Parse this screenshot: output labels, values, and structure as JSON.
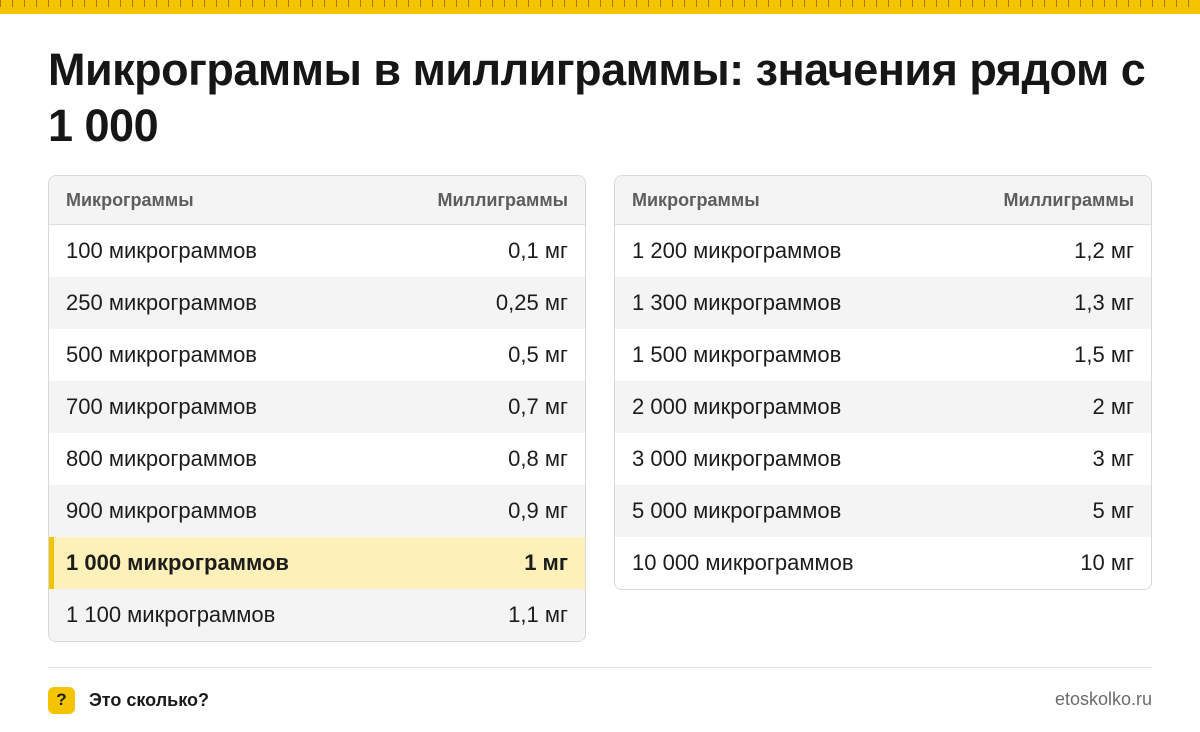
{
  "title": "Микрограммы в миллиграммы: значения рядом с 1 000",
  "tables": [
    {
      "headers": {
        "col1": "Микрограммы",
        "col2": "Миллиграммы"
      },
      "rows": [
        {
          "mcg": "100 микрограммов",
          "mg": "0,1 мг"
        },
        {
          "mcg": "250 микрограммов",
          "mg": "0,25 мг"
        },
        {
          "mcg": "500 микрограммов",
          "mg": "0,5 мг"
        },
        {
          "mcg": "700 микрограммов",
          "mg": "0,7 мг"
        },
        {
          "mcg": "800 микрограммов",
          "mg": "0,8 мг"
        },
        {
          "mcg": "900 микрограммов",
          "mg": "0,9 мг"
        },
        {
          "mcg": "1 000 микрограммов",
          "mg": "1 мг",
          "highlight": true
        },
        {
          "mcg": "1 100 микрограммов",
          "mg": "1,1 мг"
        }
      ]
    },
    {
      "headers": {
        "col1": "Микрограммы",
        "col2": "Миллиграммы"
      },
      "rows": [
        {
          "mcg": "1 200 микрограммов",
          "mg": "1,2 мг"
        },
        {
          "mcg": "1 300 микрограммов",
          "mg": "1,3 мг"
        },
        {
          "mcg": "1 500 микрограммов",
          "mg": "1,5 мг"
        },
        {
          "mcg": "2 000 микрограммов",
          "mg": "2 мг"
        },
        {
          "mcg": "3 000 микрограммов",
          "mg": "3 мг"
        },
        {
          "mcg": "5 000 микрограммов",
          "mg": "5 мг"
        },
        {
          "mcg": "10 000 микрограммов",
          "mg": "10 мг"
        }
      ]
    }
  ],
  "footer": {
    "badge_icon": "question-icon",
    "badge_symbol": "?",
    "brand": "Это сколько?",
    "site": "etoskolko.ru"
  },
  "colors": {
    "accent": "#f5c400",
    "highlight_row": "#fdf0b8",
    "zebra": "#f4f4f4"
  }
}
